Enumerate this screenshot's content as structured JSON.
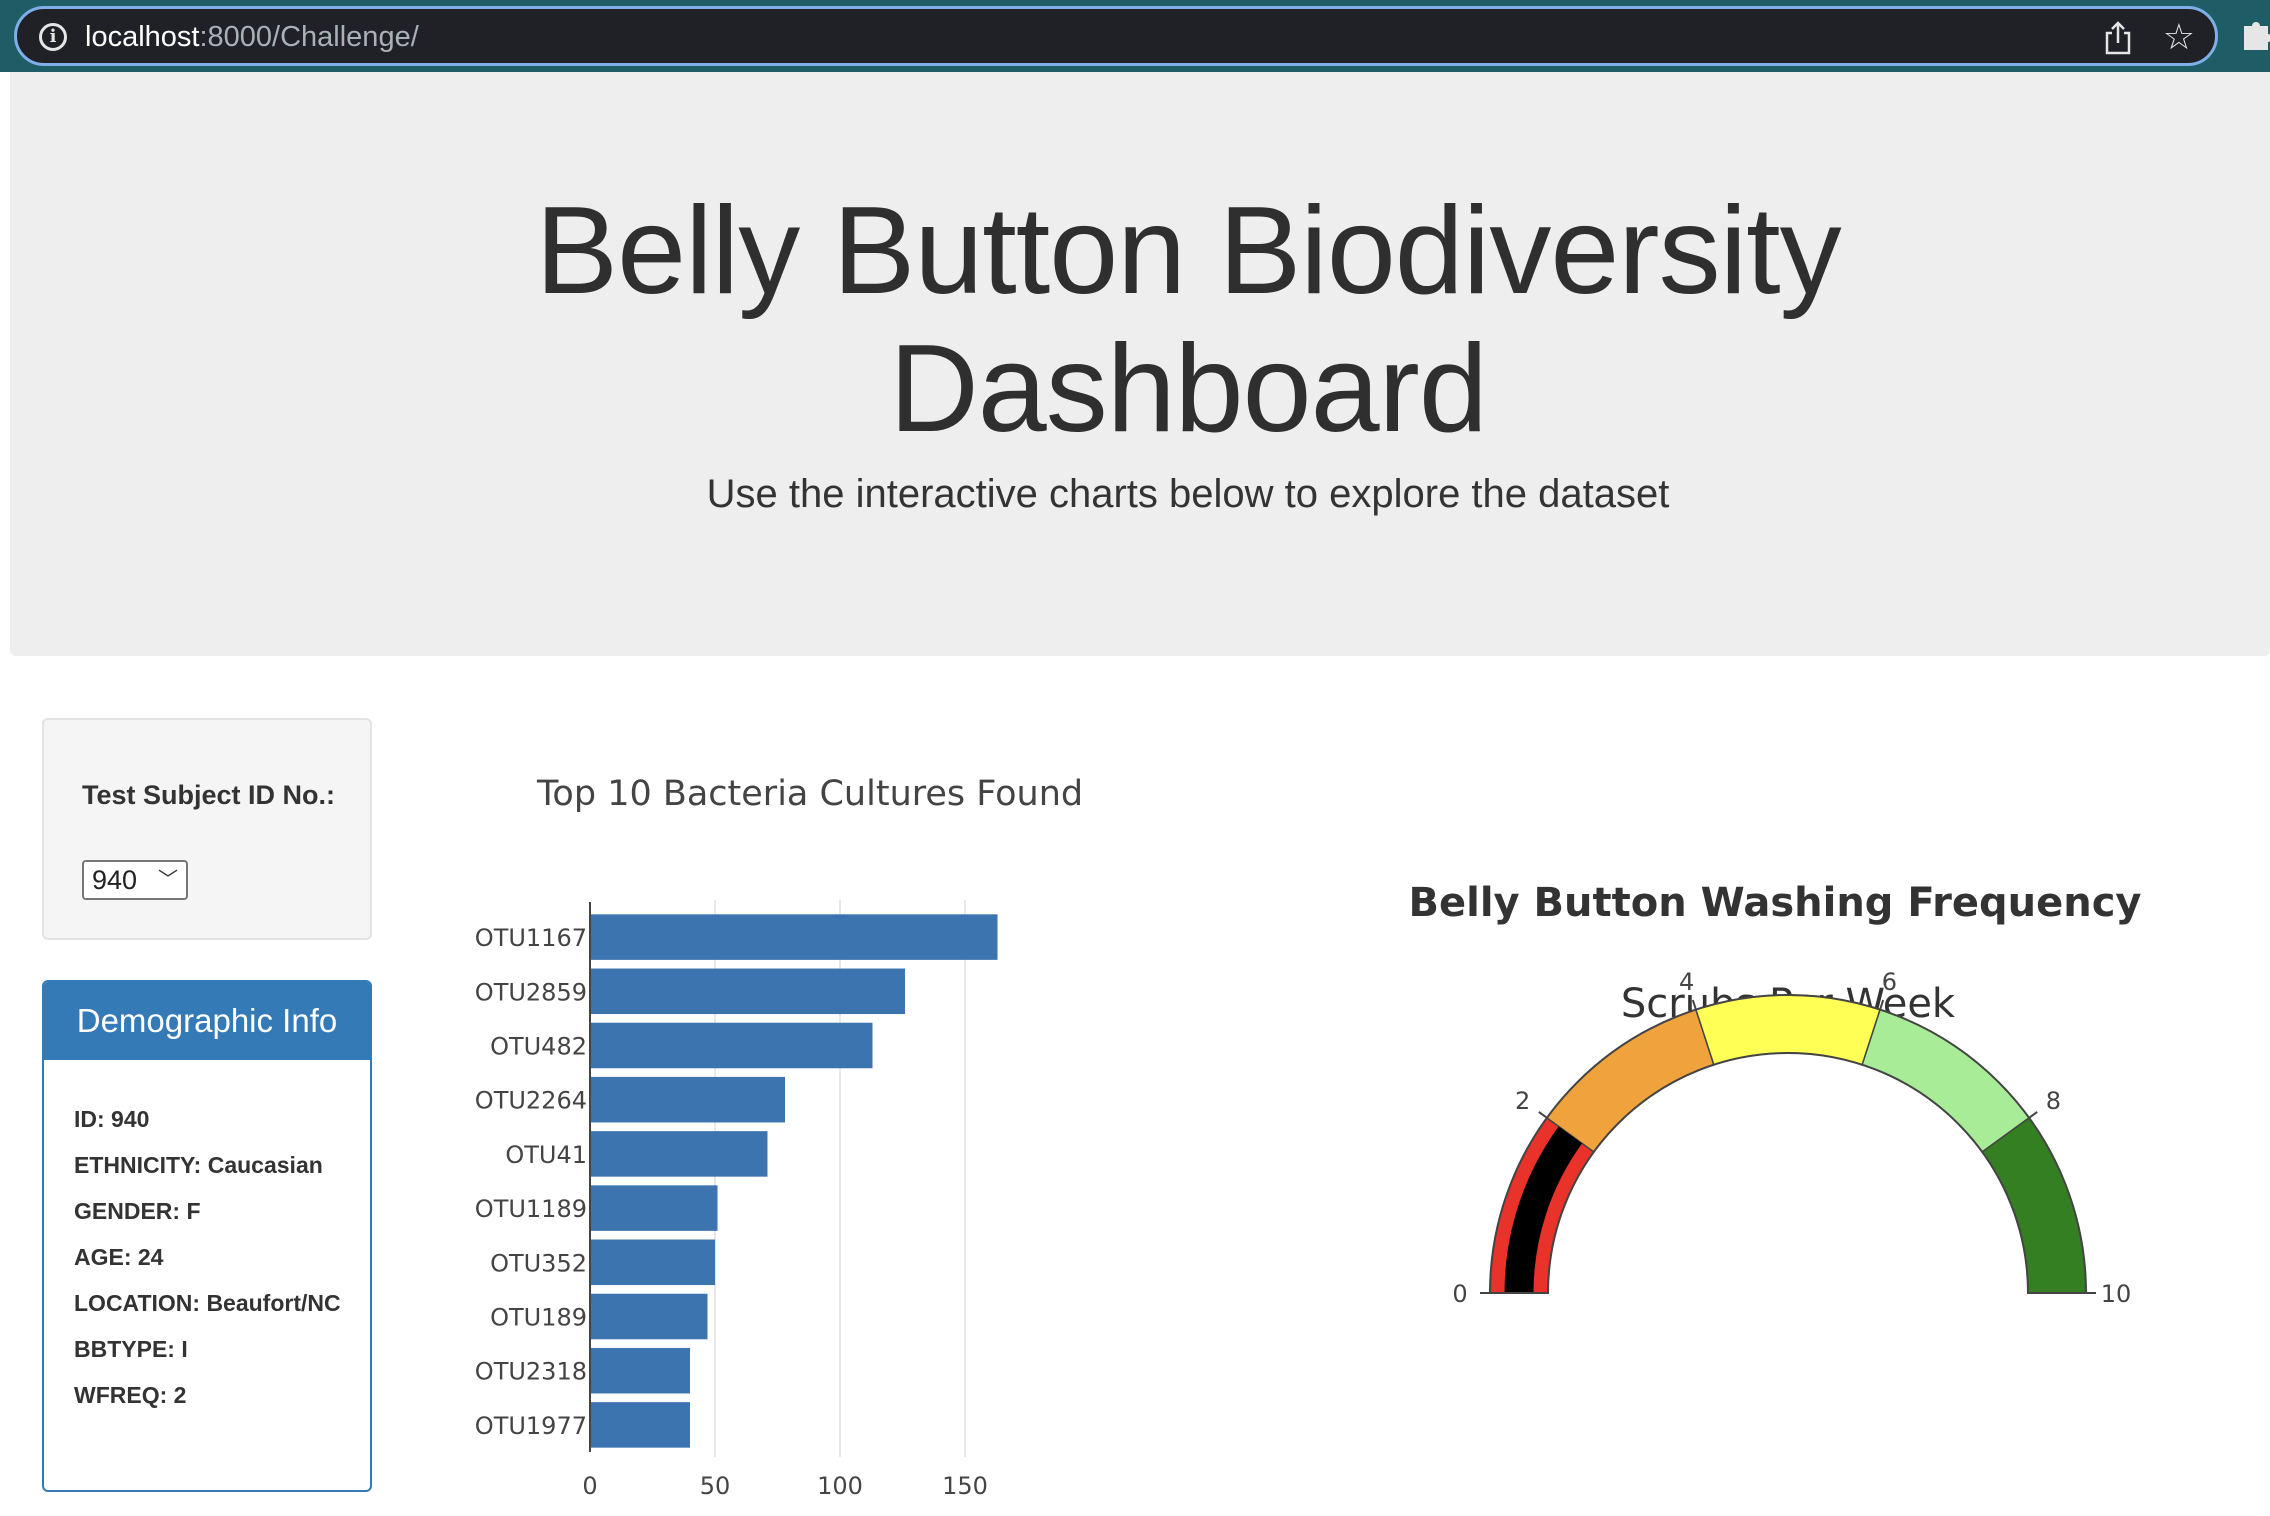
{
  "browser": {
    "url_host": "localhost",
    "url_rest": ":8000/Challenge/",
    "info_icon": "info-icon",
    "share_icon": "share-icon",
    "bookmark_icon": "star-icon",
    "extension_icon": "puzzle-icon"
  },
  "header": {
    "title_line1": "Belly Button Biodiversity",
    "title_line2": "Dashboard",
    "subtitle": "Use the interactive charts below to explore the dataset"
  },
  "selector": {
    "label": "Test Subject ID No.:",
    "selected": "940"
  },
  "demographics": {
    "heading": "Demographic Info",
    "items": [
      "ID: 940",
      "ETHNICITY: Caucasian",
      "GENDER: F",
      "AGE: 24",
      "LOCATION: Beaufort/NC",
      "BBTYPE: I",
      "WFREQ: 2"
    ]
  },
  "colors": {
    "bar": "#3c74b0",
    "panel": "#337ab7",
    "gauge_bands": [
      "#e8322a",
      "#f0a23c",
      "#ffff55",
      "#a8ec98",
      "#357f23"
    ],
    "gauge_bar": "#000000"
  },
  "chart_data": [
    {
      "type": "bar",
      "orientation": "horizontal",
      "title": "Top 10 Bacteria Cultures Found",
      "categories": [
        "OTU1167",
        "OTU2859",
        "OTU482",
        "OTU2264",
        "OTU41",
        "OTU1189",
        "OTU352",
        "OTU189",
        "OTU2318",
        "OTU1977"
      ],
      "values": [
        163,
        126,
        113,
        78,
        71,
        51,
        50,
        47,
        40,
        40
      ],
      "xlim": [
        0,
        175
      ],
      "xticks": [
        0,
        50,
        100,
        150
      ],
      "grid": true
    },
    {
      "type": "gauge",
      "title": "Belly Button Washing Frequency",
      "subtitle": "Scrubs Per Week",
      "value": 2,
      "range": [
        0,
        10
      ],
      "ticks": [
        0,
        2,
        4,
        6,
        8,
        10
      ],
      "steps": [
        [
          0,
          2
        ],
        [
          2,
          4
        ],
        [
          4,
          6
        ],
        [
          6,
          8
        ],
        [
          8,
          10
        ]
      ]
    }
  ]
}
